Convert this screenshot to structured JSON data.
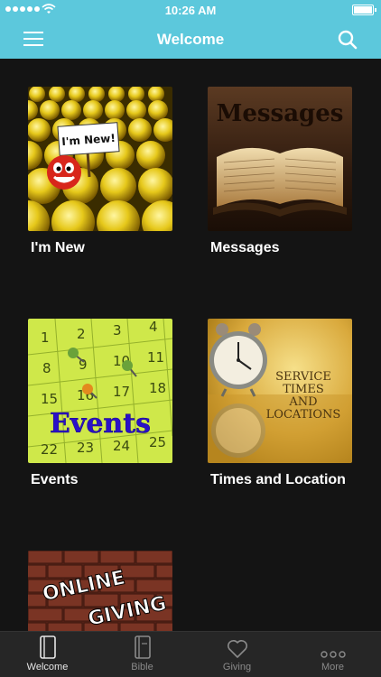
{
  "status_bar": {
    "time": "10:26 AM"
  },
  "header": {
    "title": "Welcome"
  },
  "tiles": [
    {
      "label": "I'm New",
      "sign_text": "I'm New!"
    },
    {
      "label": "Messages",
      "image_text": "Messages"
    },
    {
      "label": "Events",
      "image_text": "Events",
      "calendar_numbers": [
        "1",
        "2",
        "3",
        "4",
        "8",
        "9",
        "10",
        "11",
        "15",
        "16",
        "17",
        "18",
        "22",
        "23",
        "24",
        "25"
      ]
    },
    {
      "label": "Times and Location",
      "image_text": [
        "SERVICE",
        "TIMES",
        "AND",
        "LOCATIONS"
      ]
    },
    {
      "label": "",
      "image_text": [
        "ONLINE",
        "GIVING"
      ]
    }
  ],
  "tabbar": {
    "items": [
      {
        "label": "Welcome",
        "icon": "book-outline-icon",
        "active": true
      },
      {
        "label": "Bible",
        "icon": "bible-icon",
        "active": false
      },
      {
        "label": "Giving",
        "icon": "heart-icon",
        "active": false
      },
      {
        "label": "More",
        "icon": "more-dots-icon",
        "active": false
      }
    ]
  },
  "colors": {
    "accent": "#5cc8dc",
    "background": "#141414",
    "tabbar": "#262626"
  }
}
